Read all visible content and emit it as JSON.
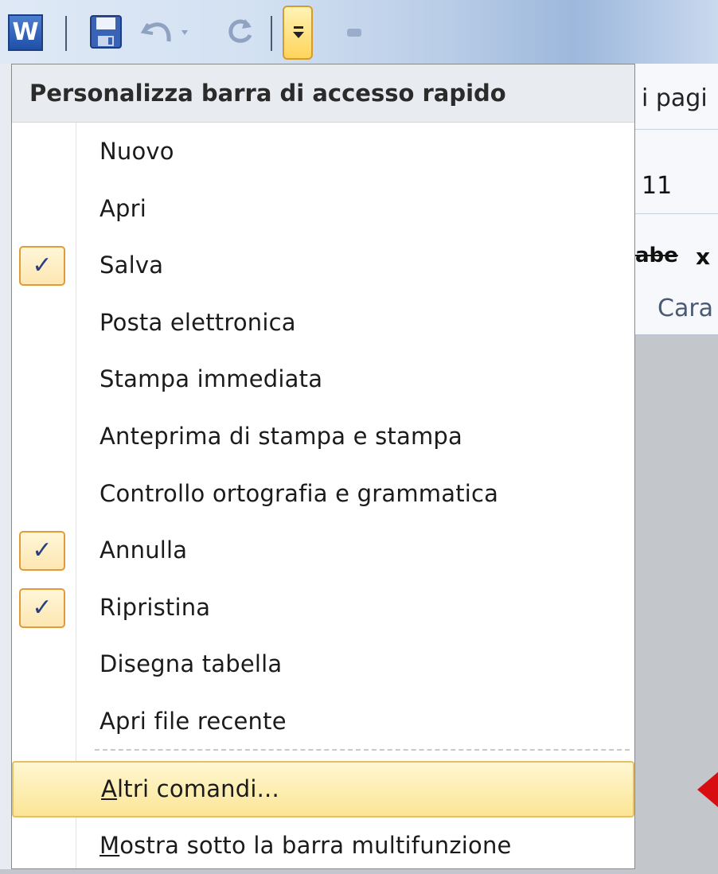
{
  "toolbar": {
    "app_icon_letter": "W",
    "customize_tooltip": ""
  },
  "ribbon_fragments": {
    "tab_fragment": "i pagi",
    "font_size": "11",
    "strikethrough": "abe",
    "subscript": "x",
    "group_label": "Cara"
  },
  "menu": {
    "title": "Personalizza barra di accesso rapido",
    "items": [
      {
        "label": "Nuovo",
        "checked": false
      },
      {
        "label": "Apri",
        "checked": false
      },
      {
        "label": "Salva",
        "checked": true
      },
      {
        "label": "Posta elettronica",
        "checked": false
      },
      {
        "label": "Stampa immediata",
        "checked": false
      },
      {
        "label": "Anteprima di stampa e stampa",
        "checked": false
      },
      {
        "label": "Controllo ortografia e grammatica",
        "checked": false
      },
      {
        "label": "Annulla",
        "checked": true
      },
      {
        "label": "Ripristina",
        "checked": true
      },
      {
        "label": "Disegna tabella",
        "checked": false
      },
      {
        "label": "Apri file recente",
        "checked": false
      }
    ],
    "more_commands": {
      "accel": "A",
      "rest": "ltri comandi..."
    },
    "show_below": {
      "accel": "M",
      "rest": "ostra sotto la barra multifunzione"
    },
    "check_glyph": "✓"
  },
  "colors": {
    "highlight": "#fbe595",
    "check_border": "#e39b3a",
    "arrow": "#d80d12"
  }
}
